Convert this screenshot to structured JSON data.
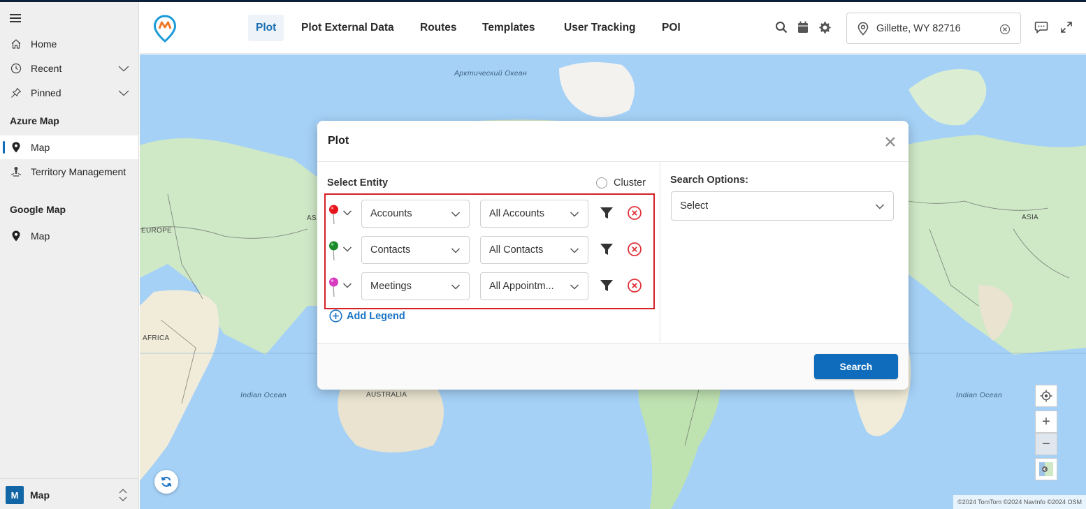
{
  "sidebar": {
    "menu_icon": "hamburger-icon",
    "items": [
      {
        "label": "Home",
        "icon": "home-icon"
      },
      {
        "label": "Recent",
        "icon": "clock-icon"
      },
      {
        "label": "Pinned",
        "icon": "pin-icon"
      }
    ],
    "sections": [
      {
        "title": "Azure Map",
        "items": [
          {
            "label": "Map",
            "icon": "map-pin-icon",
            "active": true
          },
          {
            "label": "Territory Management",
            "icon": "territory-icon",
            "active": false
          }
        ]
      },
      {
        "title": "Google Map",
        "items": [
          {
            "label": "Map",
            "icon": "map-pin-icon",
            "active": false
          }
        ]
      }
    ],
    "footer": {
      "badge": "M",
      "label": "Map"
    }
  },
  "header": {
    "tabs": [
      {
        "label": "Plot",
        "active": true
      },
      {
        "label": "Plot External Data",
        "active": false
      },
      {
        "label": "Routes",
        "active": false
      },
      {
        "label": "Templates",
        "active": false
      },
      {
        "label": "User Tracking",
        "active": false
      },
      {
        "label": "POI",
        "active": false
      }
    ],
    "icons": [
      "search-icon",
      "calendar-icon",
      "gear-icon",
      "chat-icon",
      "expand-icon"
    ],
    "location": {
      "value": "Gillette, WY 82716",
      "placeholder": ""
    }
  },
  "map": {
    "labels": {
      "arctic": "Арктический Океан",
      "indian_left": "Indian Ocean",
      "indian_right": "Indian Ocean",
      "europe": "EUROPE",
      "asia_left": "AS",
      "asia_right": "ASIA",
      "africa": "AFRICA",
      "australia": "AUSTRALIA"
    },
    "attribution": "©2024 TomTom ©2024 NavInfo ©2024 OSM",
    "controls": {
      "locate_icon": "crosshair-icon",
      "zoom_in": "+",
      "zoom_out": "−",
      "style_icon": "map-style-icon"
    },
    "refresh_icon": "refresh-icon"
  },
  "dialog": {
    "title": "Plot",
    "select_entity_label": "Select Entity",
    "cluster_label": "Cluster",
    "search_options_label": "Search Options:",
    "search_options_value": "Select",
    "rows": [
      {
        "pin_color": "#e8141b",
        "entity": "Accounts",
        "view": "All Accounts"
      },
      {
        "pin_color": "#1a8a2a",
        "entity": "Contacts",
        "view": "All Contacts"
      },
      {
        "pin_color": "#d63bc0",
        "entity": "Meetings",
        "view": "All Appointm..."
      }
    ],
    "add_legend_label": "Add Legend",
    "search_button": "Search"
  }
}
